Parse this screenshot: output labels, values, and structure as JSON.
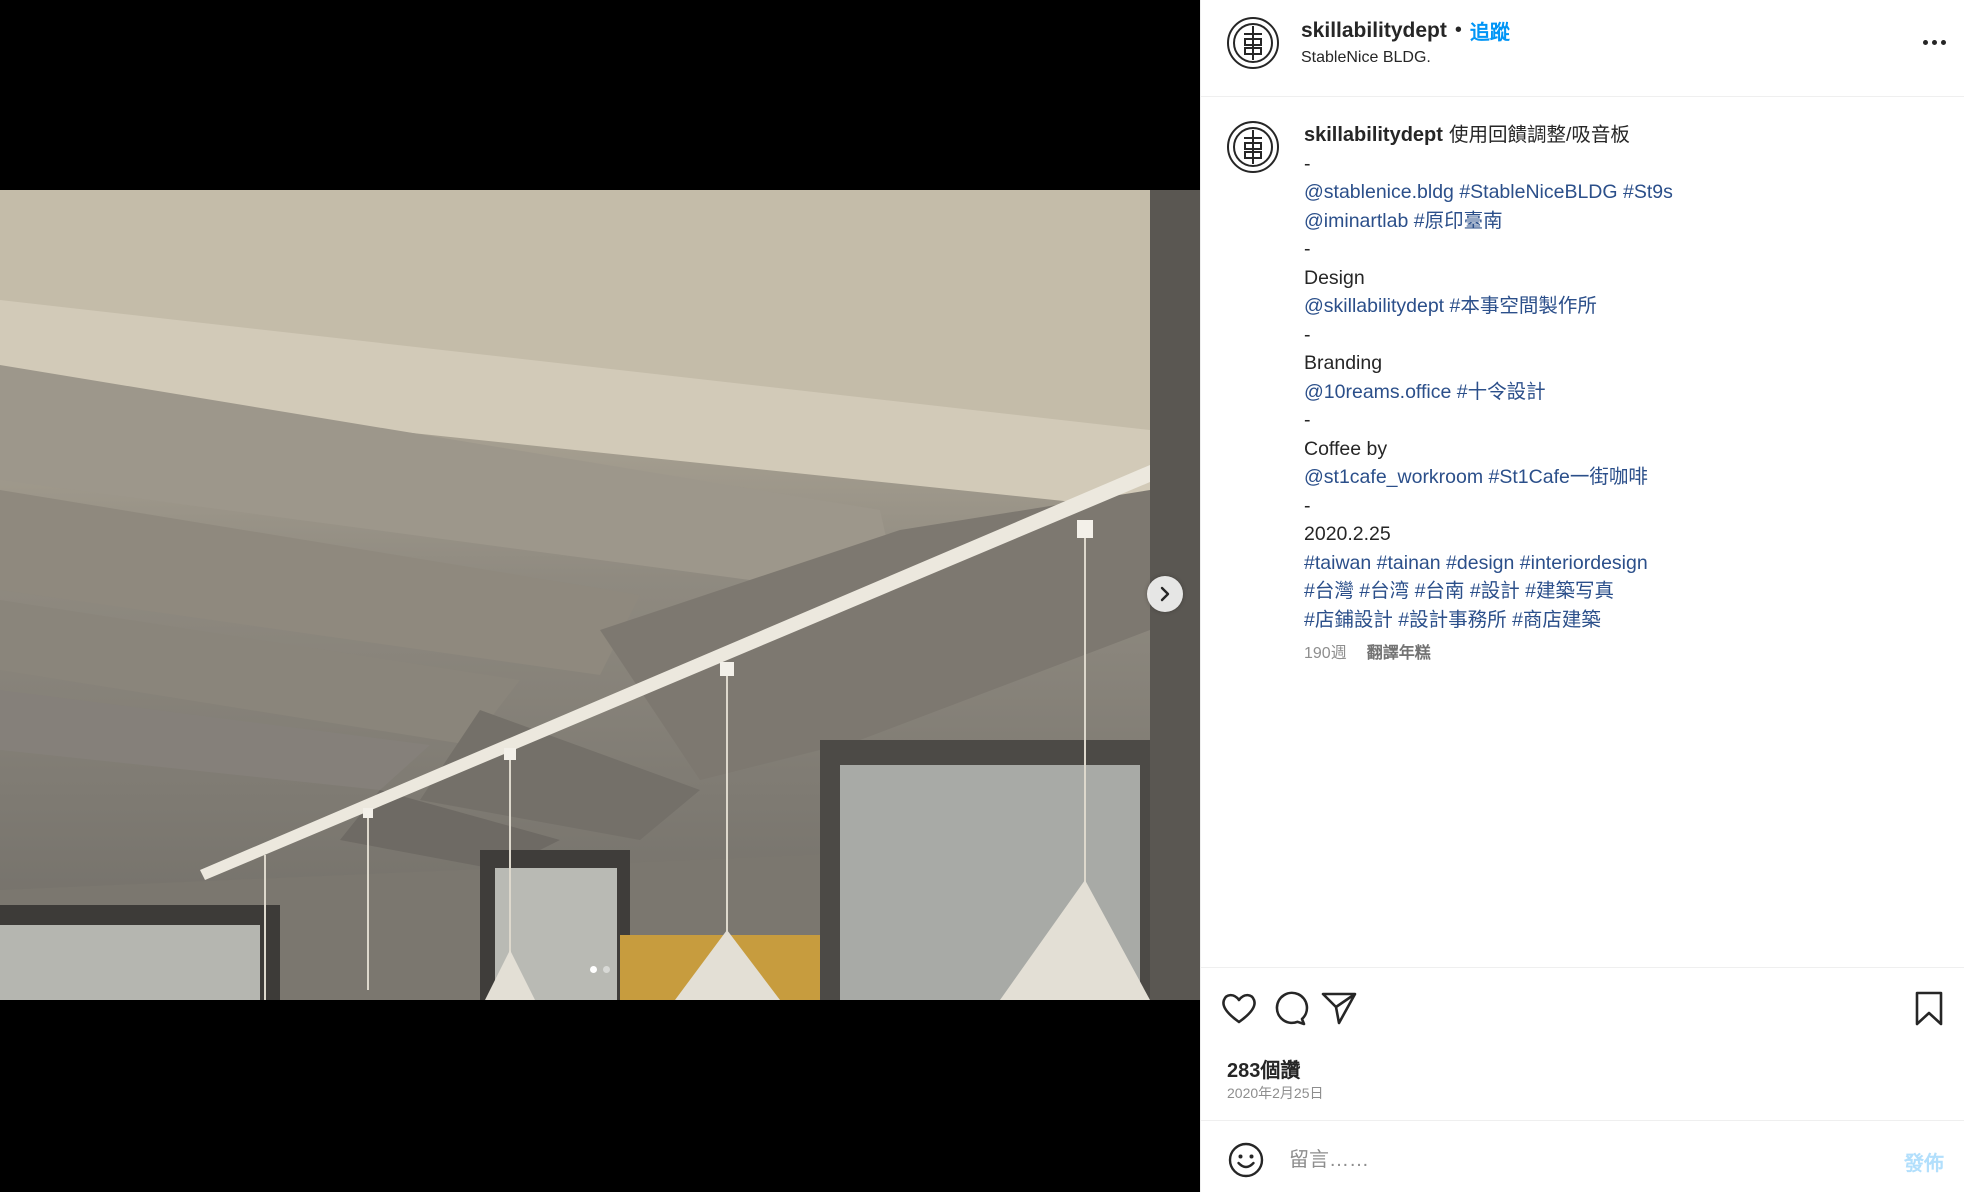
{
  "post": {
    "username": "skillabilitydept",
    "separator": "•",
    "follow_label": "追蹤",
    "location": "StableNice BLDG.",
    "avatar_glyph": "事"
  },
  "caption": {
    "username": "skillabilitydept",
    "first_line_text": "使用回饋調整/吸音板",
    "lines": [
      [
        {
          "t": "-"
        }
      ],
      [
        {
          "t": "@stablenice.bldg",
          "link": true
        },
        {
          "t": " "
        },
        {
          "t": "#StableNiceBLDG",
          "link": true
        },
        {
          "t": " "
        },
        {
          "t": "#St9s",
          "link": true
        }
      ],
      [
        {
          "t": "@iminartlab",
          "link": true
        },
        {
          "t": " "
        },
        {
          "t": "#原印臺南",
          "link": true
        }
      ],
      [
        {
          "t": "-"
        }
      ],
      [
        {
          "t": "Design"
        }
      ],
      [
        {
          "t": "@skillabilitydept",
          "link": true
        },
        {
          "t": " "
        },
        {
          "t": "#本事空間製作所",
          "link": true
        }
      ],
      [
        {
          "t": "-"
        }
      ],
      [
        {
          "t": "Branding"
        }
      ],
      [
        {
          "t": "@10reams.office",
          "link": true
        },
        {
          "t": " "
        },
        {
          "t": "#十令設計",
          "link": true
        }
      ],
      [
        {
          "t": "-"
        }
      ],
      [
        {
          "t": "Coffee by"
        }
      ],
      [
        {
          "t": "@st1cafe_workroom",
          "link": true
        },
        {
          "t": " "
        },
        {
          "t": "#St1Cafe一街咖啡",
          "link": true
        }
      ],
      [
        {
          "t": "-"
        }
      ],
      [
        {
          "t": "2020.2.25"
        }
      ],
      [
        {
          "t": "#taiwan",
          "link": true
        },
        {
          "t": " "
        },
        {
          "t": "#tainan",
          "link": true
        },
        {
          "t": " "
        },
        {
          "t": "#design",
          "link": true
        },
        {
          "t": " "
        },
        {
          "t": "#interiordesign",
          "link": true
        }
      ],
      [
        {
          "t": "#台灣",
          "link": true
        },
        {
          "t": " "
        },
        {
          "t": "#台湾",
          "link": true
        },
        {
          "t": " "
        },
        {
          "t": "#台南",
          "link": true
        },
        {
          "t": " "
        },
        {
          "t": "#設計",
          "link": true
        },
        {
          "t": " "
        },
        {
          "t": "#建築写真",
          "link": true
        }
      ],
      [
        {
          "t": "#店鋪設計",
          "link": true
        },
        {
          "t": " "
        },
        {
          "t": "#設計事務所",
          "link": true
        },
        {
          "t": " "
        },
        {
          "t": "#商店建築",
          "link": true
        }
      ]
    ],
    "time_ago": "190週",
    "translate_label": "翻譯年糕"
  },
  "actions": {
    "icons": [
      "heart-icon",
      "comment-icon",
      "share-icon",
      "bookmark-icon"
    ],
    "likes": "283個讚",
    "date": "2020年2月25日"
  },
  "comment_box": {
    "placeholder": "留言……",
    "post_label": "發佈"
  },
  "carousel": {
    "slide_count": 2,
    "active_index": 0
  },
  "colors": {
    "link": "#2b4f8a",
    "follow": "#0095f6",
    "post_disabled": "#b2dffc"
  }
}
